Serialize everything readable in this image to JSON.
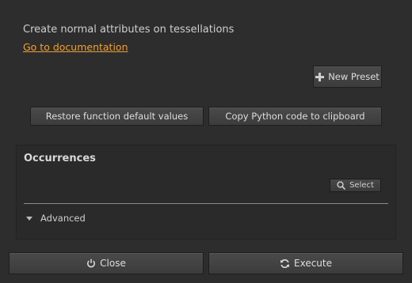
{
  "description": "Create normal attributes on tessellations",
  "documentation_link": "Go to documentation",
  "buttons": {
    "new_preset": "New Preset",
    "restore_defaults": "Restore function default values",
    "copy_python": "Copy Python code to clipboard",
    "close": "Close",
    "execute": "Execute"
  },
  "occurrences": {
    "title": "Occurrences",
    "select_label": "Select",
    "advanced_label": "Advanced"
  },
  "icons": {
    "new_preset": "plus-icon",
    "select": "search-icon",
    "advanced": "triangle-down-icon",
    "close": "power-icon",
    "execute": "refresh-icon"
  },
  "colors": {
    "background": "#2d2d2d",
    "link": "#f0a030"
  }
}
